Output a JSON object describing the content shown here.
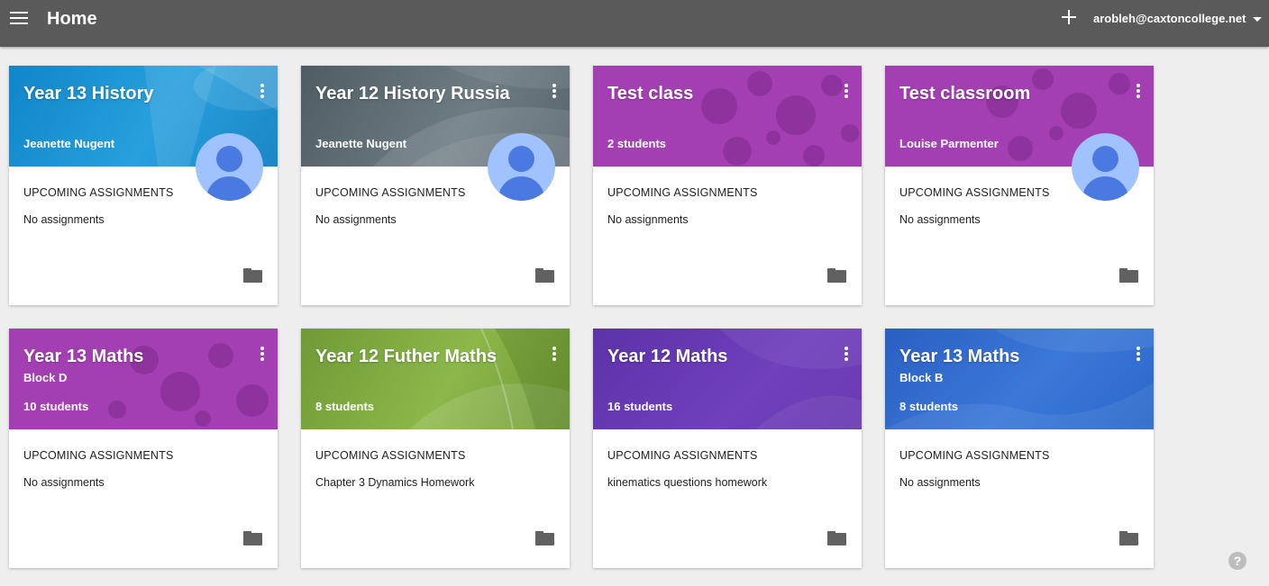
{
  "header": {
    "title": "Home",
    "account_email": "arobleh@caxtoncollege.net",
    "menu_icon": "hamburger-menu-icon",
    "add_icon": "plus-icon",
    "dropdown_icon": "caret-down-icon"
  },
  "upcoming_label": "UPCOMING ASSIGNMENTS",
  "classes": [
    {
      "name": "Year 13 History",
      "section": "",
      "subtitle": "Jeanette Nugent",
      "assignment": "No assignments",
      "avatar": true,
      "theme": "#1e8bc3"
    },
    {
      "name": "Year 12 History Russia",
      "section": "",
      "subtitle": "Jeanette Nugent",
      "assignment": "No assignments",
      "avatar": true,
      "theme": "#5d6b73"
    },
    {
      "name": "Test class",
      "section": "",
      "subtitle": "2 students",
      "assignment": "No assignments",
      "avatar": false,
      "theme": "#a43fb3"
    },
    {
      "name": "Test classroom",
      "section": "",
      "subtitle": "Louise Parmenter",
      "assignment": "No assignments",
      "avatar": true,
      "theme": "#a43fb3"
    },
    {
      "name": "Year 13 Maths",
      "section": "Block D",
      "subtitle": "10 students",
      "assignment": "No assignments",
      "avatar": false,
      "theme": "#a43fb3"
    },
    {
      "name": "Year 12 Futher Maths",
      "section": "",
      "subtitle": "8 students",
      "assignment": "Chapter 3 Dynamics Homework",
      "avatar": false,
      "theme": "#7ba23f"
    },
    {
      "name": "Year 12 Maths",
      "section": "",
      "subtitle": "16 students",
      "assignment": "kinematics questions homework",
      "avatar": false,
      "theme": "#6a3bb0"
    },
    {
      "name": "Year 13 Maths",
      "section": "Block B",
      "subtitle": "8 students",
      "assignment": "No assignments",
      "avatar": false,
      "theme": "#2a67c9"
    }
  ],
  "help_icon": "help-circle-icon"
}
